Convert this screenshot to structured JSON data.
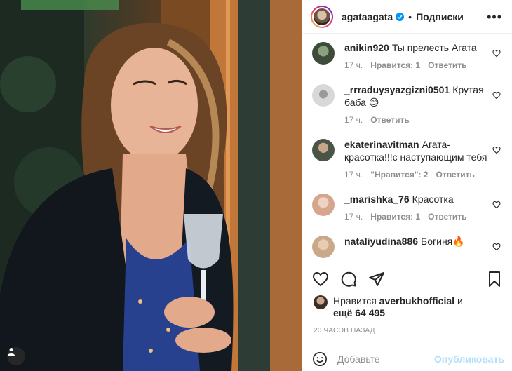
{
  "post": {
    "username": "agataagata",
    "follow_label": "Подписки",
    "separator": "•",
    "more_label": "•••"
  },
  "comments": [
    {
      "user": "anikin920",
      "text": "Ты прелесть Агата",
      "time": "17 ч.",
      "likes": "Нравится: 1",
      "reply": "Ответить",
      "avatar_color": "#3d4b3a"
    },
    {
      "user": "_rrraduysyazgizni0501",
      "text": "Крутая баба 😊",
      "time": "17 ч.",
      "likes": "",
      "reply": "Ответить",
      "avatar_color": "#d8d8d8"
    },
    {
      "user": "ekaterinavitman",
      "text": "Агата-красотка!!!с наступающим тебя",
      "time": "17 ч.",
      "likes": "\"Нравится\": 2",
      "reply": "Ответить",
      "avatar_color": "#4a5548"
    },
    {
      "user": "_marishka_76",
      "text": "Красотка",
      "time": "17 ч.",
      "likes": "Нравится: 1",
      "reply": "Ответить",
      "avatar_color": "#d6a58e"
    },
    {
      "user": "nataliyudina886",
      "text": "Богиня🔥",
      "time": "",
      "likes": "",
      "reply": "",
      "avatar_color": "#caa98a"
    }
  ],
  "likes": {
    "prefix": "Нравится",
    "user": "averbukhofficial",
    "and": "и",
    "rest": "ещё 64 495"
  },
  "timestamp": "20 ЧАСОВ НАЗАД",
  "composer": {
    "placeholder": "Добавьте",
    "publish_label": "Опубликовать"
  },
  "colors": {
    "verified": "#0095f6",
    "publish_disabled": "#b2dffc",
    "meta": "#8e8e8e"
  },
  "icons": [
    "heart-icon",
    "comment-icon",
    "share-icon",
    "bookmark-icon",
    "emoji-icon",
    "more-icon",
    "verified-icon",
    "user-icon"
  ]
}
